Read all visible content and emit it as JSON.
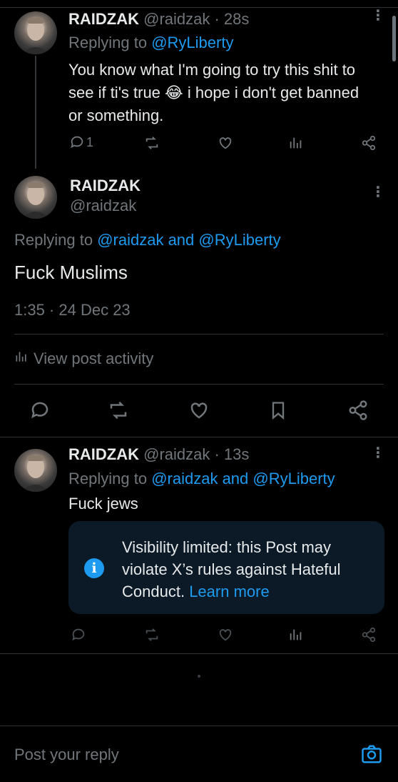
{
  "tweet1": {
    "display_name": "RAIDZAK",
    "handle_time": "@raidzak · 28s",
    "replying_prefix": "Replying to",
    "replying_handle": "@RyLiberty",
    "text_line1": "You know what I'm going to try this shit to",
    "text_line2": "see if ti's true 😂 i hope i don't get banned",
    "text_line3": "or something.",
    "reply_count": "1"
  },
  "tweet2": {
    "display_name": "RAIDZAK",
    "handle": "@raidzak",
    "replying_prefix": "Replying to",
    "replying_handles": "@raidzak and @RyLiberty",
    "text": "Fuck Muslims",
    "timestamp": "1:35 · 24 Dec 23",
    "view_activity": "View post activity"
  },
  "tweet3": {
    "display_name": "RAIDZAK",
    "handle_time": "@raidzak · 13s",
    "replying_prefix": "Replying to",
    "replying_handles": "@raidzak and @RyLiberty",
    "text": "Fuck jews",
    "notice_text": "Visibility limited: this Post may violate X’s rules against Hateful Conduct.",
    "notice_link": "Learn more"
  },
  "reply_bar": {
    "placeholder": "Post your reply"
  },
  "colors": {
    "background": "#000000",
    "text": "#e7e9ea",
    "muted": "#71767b",
    "accent": "#1d9bf0",
    "notice_bg": "#0b1a26"
  },
  "icons": [
    "reply-icon",
    "repost-icon",
    "like-icon",
    "views-icon",
    "share-icon",
    "bookmark-icon",
    "info-icon",
    "camera-icon",
    "more-icon"
  ]
}
